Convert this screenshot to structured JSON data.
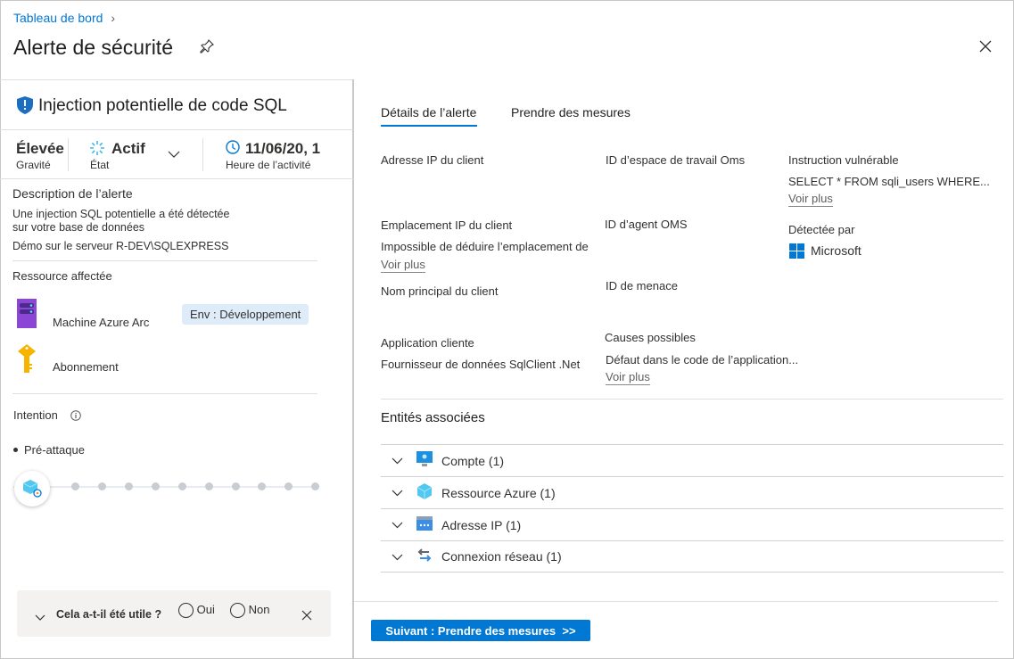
{
  "breadcrumb": {
    "item": "Tableau de bord"
  },
  "header": {
    "title": "Alerte de sécurité"
  },
  "alert": {
    "title": "Injection potentielle de code SQL",
    "severity": {
      "value": "Élevée",
      "label": "Gravité"
    },
    "state": {
      "value": "Actif",
      "label": "État"
    },
    "time": {
      "value": "11/06/20, 1",
      "label": "Heure de l’activité"
    },
    "description": {
      "heading": "Description de l’alerte",
      "text1": "Une injection SQL potentielle a été détectée",
      "text2": "sur votre base de données",
      "text3": "Démo sur le serveur R-DEV\\SQLEXPRESS"
    },
    "resource": {
      "heading": "Ressource affectée",
      "machine": "Machine Azure Arc",
      "tag": "Env : Développement",
      "subscription": "Abonnement"
    },
    "intent": {
      "heading": "Intention",
      "stage": "Pré-attaque"
    }
  },
  "feedback": {
    "question": "Cela a-t-il été utile ?",
    "yes": "Oui",
    "no": "Non"
  },
  "tabs": [
    {
      "label": "Détails de l’alerte"
    },
    {
      "label": "Prendre des mesures"
    }
  ],
  "details": {
    "client_ip": "Adresse IP du client",
    "workspace_id": "ID d’espace de travail Oms",
    "vuln_statement": "Instruction vulnérable",
    "vuln_value": "SELECT * FROM sqli_users WHERE...",
    "see_more": "Voir plus",
    "ip_location": "Emplacement IP du client",
    "ip_location_value": "Impossible de déduire l’emplacement de",
    "agent_id": "ID d’agent OMS",
    "detected_by": "Détectée par",
    "detected_by_value": "Microsoft",
    "principal": "Nom principal du client",
    "threat_id": "ID de menace",
    "app": "Application cliente",
    "app_value": "Fournisseur de données SqlClient .Net",
    "causes": "Causes possibles",
    "causes_value": "Défaut dans le code de l’application..."
  },
  "entities": {
    "heading": "Entités associées",
    "items": [
      {
        "label": "Compte (1)"
      },
      {
        "label": "Ressource Azure (1)"
      },
      {
        "label": "Adresse IP (1)"
      },
      {
        "label": "Connexion réseau (1)"
      }
    ]
  },
  "next_button": "Suivant : Prendre des mesures  >>",
  "colors": {
    "accent": "#0078d4",
    "tag_bg": "#deecf9",
    "feedback_bg": "#f3f2f1"
  }
}
